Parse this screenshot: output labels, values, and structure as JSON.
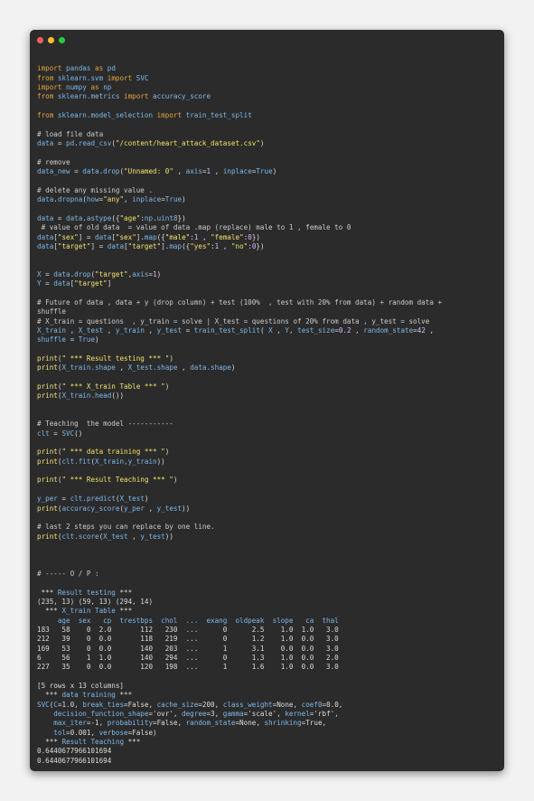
{
  "window": {
    "buttons": [
      {
        "name": "close",
        "color": "#ff5f57"
      },
      {
        "name": "minimize",
        "color": "#febc2e"
      },
      {
        "name": "maximize",
        "color": "#28c840"
      }
    ]
  },
  "colors": {
    "default": "#dcdcdc",
    "keyword": "#e8a33d",
    "ident": "#7eb8ea",
    "string": "#f2e36b",
    "number": "#d9b8ff",
    "comment": "#cccccc",
    "builtin": "#f5e07a"
  },
  "code_lines": [
    [],
    [
      [
        "k",
        "import"
      ],
      [
        "d",
        " "
      ],
      [
        "i",
        "pandas"
      ],
      [
        "d",
        " "
      ],
      [
        "k",
        "as"
      ],
      [
        "d",
        " "
      ],
      [
        "i",
        "pd"
      ]
    ],
    [
      [
        "k",
        "from"
      ],
      [
        "d",
        " "
      ],
      [
        "i",
        "sklearn.svm"
      ],
      [
        "d",
        " "
      ],
      [
        "k",
        "import"
      ],
      [
        "d",
        " "
      ],
      [
        "i",
        "SVC"
      ]
    ],
    [
      [
        "k",
        "import"
      ],
      [
        "d",
        " "
      ],
      [
        "i",
        "numpy"
      ],
      [
        "d",
        " "
      ],
      [
        "k",
        "as"
      ],
      [
        "d",
        " "
      ],
      [
        "i",
        "np"
      ]
    ],
    [
      [
        "k",
        "from"
      ],
      [
        "d",
        " "
      ],
      [
        "i",
        "sklearn.metrics"
      ],
      [
        "d",
        " "
      ],
      [
        "k",
        "import"
      ],
      [
        "d",
        " "
      ],
      [
        "i",
        "accuracy_score"
      ]
    ],
    [],
    [
      [
        "k",
        "from"
      ],
      [
        "d",
        " "
      ],
      [
        "i",
        "sklearn.model_selection"
      ],
      [
        "d",
        " "
      ],
      [
        "k",
        "import"
      ],
      [
        "d",
        " "
      ],
      [
        "i",
        "train_test_split"
      ]
    ],
    [],
    [
      [
        "c",
        "# load file data"
      ]
    ],
    [
      [
        "i",
        "data"
      ],
      [
        "d",
        " = "
      ],
      [
        "i",
        "pd"
      ],
      [
        "d",
        "."
      ],
      [
        "i",
        "read_csv"
      ],
      [
        "d",
        "("
      ],
      [
        "s",
        "\"/content/heart_attack_dataset.csv\""
      ],
      [
        "d",
        ")"
      ]
    ],
    [],
    [
      [
        "c",
        "# remove"
      ]
    ],
    [
      [
        "i",
        "data_new"
      ],
      [
        "d",
        " = "
      ],
      [
        "i",
        "data"
      ],
      [
        "d",
        "."
      ],
      [
        "i",
        "drop"
      ],
      [
        "d",
        "("
      ],
      [
        "s",
        "\"Unnamed: 0\""
      ],
      [
        "d",
        " , "
      ],
      [
        "i",
        "axis"
      ],
      [
        "d",
        "="
      ],
      [
        "n",
        "1"
      ],
      [
        "d",
        " , "
      ],
      [
        "i",
        "inplace"
      ],
      [
        "d",
        "="
      ],
      [
        "i",
        "True"
      ],
      [
        "d",
        ")"
      ]
    ],
    [],
    [
      [
        "c",
        "# delete any missing value ."
      ]
    ],
    [
      [
        "i",
        "data"
      ],
      [
        "d",
        "."
      ],
      [
        "i",
        "dropna"
      ],
      [
        "d",
        "("
      ],
      [
        "i",
        "how"
      ],
      [
        "d",
        "="
      ],
      [
        "s",
        "\"any\""
      ],
      [
        "d",
        ", "
      ],
      [
        "i",
        "inplace"
      ],
      [
        "d",
        "="
      ],
      [
        "i",
        "True"
      ],
      [
        "d",
        ")"
      ]
    ],
    [],
    [
      [
        "i",
        "data"
      ],
      [
        "d",
        " = "
      ],
      [
        "i",
        "data"
      ],
      [
        "d",
        "."
      ],
      [
        "i",
        "astype"
      ],
      [
        "d",
        "({"
      ],
      [
        "s",
        "\"age\""
      ],
      [
        "d",
        ":"
      ],
      [
        "i",
        "np"
      ],
      [
        "d",
        "."
      ],
      [
        "i",
        "uint8"
      ],
      [
        "d",
        "})"
      ]
    ],
    [
      [
        "c",
        " # value of old data  = value of data .map (replace) male to 1 , female to 0"
      ]
    ],
    [
      [
        "i",
        "data"
      ],
      [
        "d",
        "["
      ],
      [
        "s",
        "\"sex\""
      ],
      [
        "d",
        "] = "
      ],
      [
        "i",
        "data"
      ],
      [
        "d",
        "["
      ],
      [
        "s",
        "\"sex\""
      ],
      [
        "d",
        "]."
      ],
      [
        "i",
        "map"
      ],
      [
        "d",
        "({"
      ],
      [
        "s",
        "\"male\""
      ],
      [
        "d",
        ":"
      ],
      [
        "n",
        "1"
      ],
      [
        "d",
        " , "
      ],
      [
        "s",
        "\"female\""
      ],
      [
        "d",
        ":"
      ],
      [
        "n",
        "0"
      ],
      [
        "d",
        "})"
      ]
    ],
    [
      [
        "i",
        "data"
      ],
      [
        "d",
        "["
      ],
      [
        "s",
        "\"target\""
      ],
      [
        "d",
        "] = "
      ],
      [
        "i",
        "data"
      ],
      [
        "d",
        "["
      ],
      [
        "s",
        "\"target\""
      ],
      [
        "d",
        "]."
      ],
      [
        "i",
        "map"
      ],
      [
        "d",
        "({"
      ],
      [
        "s",
        "\"yes\""
      ],
      [
        "d",
        ":"
      ],
      [
        "n",
        "1"
      ],
      [
        "d",
        " , "
      ],
      [
        "s",
        "\"no\""
      ],
      [
        "d",
        ":"
      ],
      [
        "n",
        "0"
      ],
      [
        "d",
        "})"
      ]
    ],
    [],
    [],
    [
      [
        "i",
        "X"
      ],
      [
        "d",
        " = "
      ],
      [
        "i",
        "data"
      ],
      [
        "d",
        "."
      ],
      [
        "i",
        "drop"
      ],
      [
        "d",
        "("
      ],
      [
        "s",
        "\"target\""
      ],
      [
        "d",
        ","
      ],
      [
        "i",
        "axis"
      ],
      [
        "d",
        "="
      ],
      [
        "n",
        "1"
      ],
      [
        "d",
        ")"
      ]
    ],
    [
      [
        "i",
        "Y"
      ],
      [
        "d",
        " = "
      ],
      [
        "i",
        "data"
      ],
      [
        "d",
        "["
      ],
      [
        "s",
        "\"target\""
      ],
      [
        "d",
        "]"
      ]
    ],
    [],
    [
      [
        "c",
        "# Future of data , data + y (drop column) + test (100%  , test with 20% from data) + random data +"
      ]
    ],
    [
      [
        "c",
        "shuffle"
      ]
    ],
    [
      [
        "c",
        "# X_train = questions  , y_train = solve | X_test = questions of 20% from data , y_test = solve"
      ]
    ],
    [
      [
        "i",
        "X_train"
      ],
      [
        "d",
        " , "
      ],
      [
        "i",
        "X_test"
      ],
      [
        "d",
        " , "
      ],
      [
        "i",
        "y_train"
      ],
      [
        "d",
        " , "
      ],
      [
        "i",
        "y_test"
      ],
      [
        "d",
        " = "
      ],
      [
        "i",
        "train_test_split"
      ],
      [
        "d",
        "( "
      ],
      [
        "i",
        "X"
      ],
      [
        "d",
        " , "
      ],
      [
        "i",
        "Y"
      ],
      [
        "d",
        ", "
      ],
      [
        "i",
        "test_size"
      ],
      [
        "d",
        "="
      ],
      [
        "n",
        "0.2"
      ],
      [
        "d",
        " , "
      ],
      [
        "i",
        "random_state"
      ],
      [
        "d",
        "="
      ],
      [
        "n",
        "42"
      ],
      [
        "d",
        " ,"
      ]
    ],
    [
      [
        "i",
        "shuffle"
      ],
      [
        "d",
        " = "
      ],
      [
        "i",
        "True"
      ],
      [
        "d",
        ")"
      ]
    ],
    [],
    [
      [
        "b",
        "print"
      ],
      [
        "d",
        "("
      ],
      [
        "s",
        "\" *** Result testing *** \""
      ],
      [
        "d",
        ")"
      ]
    ],
    [
      [
        "b",
        "print"
      ],
      [
        "d",
        "("
      ],
      [
        "i",
        "X_train.shape"
      ],
      [
        "d",
        " , "
      ],
      [
        "i",
        "X_test.shape"
      ],
      [
        "d",
        " , "
      ],
      [
        "i",
        "data.shape"
      ],
      [
        "d",
        ")"
      ]
    ],
    [],
    [
      [
        "b",
        "print"
      ],
      [
        "d",
        "("
      ],
      [
        "s",
        "\" *** X_train Table *** \""
      ],
      [
        "d",
        ")"
      ]
    ],
    [
      [
        "b",
        "print"
      ],
      [
        "d",
        "("
      ],
      [
        "i",
        "X_train.head"
      ],
      [
        "d",
        "())"
      ]
    ],
    [],
    [],
    [
      [
        "c",
        "# Teaching  the model -----------"
      ]
    ],
    [
      [
        "i",
        "clt"
      ],
      [
        "d",
        " = "
      ],
      [
        "i",
        "SVC"
      ],
      [
        "d",
        "()"
      ]
    ],
    [],
    [
      [
        "b",
        "print"
      ],
      [
        "d",
        "("
      ],
      [
        "s",
        "\" *** data training *** \""
      ],
      [
        "d",
        ")"
      ]
    ],
    [
      [
        "b",
        "print"
      ],
      [
        "d",
        "("
      ],
      [
        "i",
        "clt.fit"
      ],
      [
        "d",
        "("
      ],
      [
        "i",
        "X_train,y_train"
      ],
      [
        "d",
        "))"
      ]
    ],
    [],
    [
      [
        "b",
        "print"
      ],
      [
        "d",
        "("
      ],
      [
        "s",
        "\" *** Result Teaching *** \""
      ],
      [
        "d",
        ")"
      ]
    ],
    [],
    [
      [
        "i",
        "y_per"
      ],
      [
        "d",
        " = "
      ],
      [
        "i",
        "clt.predict"
      ],
      [
        "d",
        "("
      ],
      [
        "i",
        "X_test"
      ],
      [
        "d",
        ")"
      ]
    ],
    [
      [
        "b",
        "print"
      ],
      [
        "d",
        "("
      ],
      [
        "i",
        "accuracy_score"
      ],
      [
        "d",
        "("
      ],
      [
        "i",
        "y_per"
      ],
      [
        "d",
        " , "
      ],
      [
        "i",
        "y_test"
      ],
      [
        "d",
        "))"
      ]
    ],
    [],
    [
      [
        "c",
        "# last 2 steps you can replace by one line."
      ]
    ],
    [
      [
        "b",
        "print"
      ],
      [
        "d",
        "("
      ],
      [
        "i",
        "clt.score"
      ],
      [
        "d",
        "("
      ],
      [
        "i",
        "X_test"
      ],
      [
        "d",
        " , "
      ],
      [
        "i",
        "y_test"
      ],
      [
        "d",
        "))"
      ]
    ],
    [],
    [],
    [],
    [
      [
        "c",
        "# ----- O / P :"
      ]
    ],
    [],
    [
      [
        "d",
        " *** "
      ],
      [
        "i",
        "Result testing"
      ],
      [
        "d",
        " ***"
      ]
    ],
    [
      [
        "d",
        "(235, 13) (59, 13) (294, 14)"
      ]
    ],
    [
      [
        "d",
        "  *** "
      ],
      [
        "i",
        "X_train Table"
      ],
      [
        "d",
        " ***"
      ]
    ],
    [
      [
        "i",
        "     age  sex   cp  trestbps  chol  ...  exang  oldpeak  slope   ca  thal"
      ]
    ],
    [
      [
        "d",
        "183   58    0  2.0       112   230  ...      0      2.5    1.0  1.0   3.0"
      ]
    ],
    [
      [
        "d",
        "212   39    0  0.0       118   219  ...      0      1.2    1.0  0.0   3.0"
      ]
    ],
    [
      [
        "d",
        "169   53    0  0.0       140   203  ...      1      3.1    0.0  0.0   3.0"
      ]
    ],
    [
      [
        "d",
        "6     56    1  1.0       140   294  ...      0      1.3    1.0  0.0   2.0"
      ]
    ],
    [
      [
        "d",
        "227   35    0  0.0       120   198  ...      1      1.6    1.0  0.0   3.0"
      ]
    ],
    [],
    [
      [
        "d",
        "[5 rows x 13 columns]"
      ]
    ],
    [
      [
        "d",
        "  *** "
      ],
      [
        "i",
        "data training"
      ],
      [
        "d",
        " ***"
      ]
    ],
    [
      [
        "i",
        "SVC"
      ],
      [
        "d",
        "("
      ],
      [
        "i",
        "C"
      ],
      [
        "d",
        "=1.0, "
      ],
      [
        "i",
        "break_ties"
      ],
      [
        "d",
        "=False, "
      ],
      [
        "i",
        "cache_size"
      ],
      [
        "d",
        "=200, "
      ],
      [
        "i",
        "class_weight"
      ],
      [
        "d",
        "=None, "
      ],
      [
        "i",
        "coef0"
      ],
      [
        "d",
        "=0.0,"
      ]
    ],
    [
      [
        "d",
        "    "
      ],
      [
        "i",
        "decision_function_shape"
      ],
      [
        "d",
        "='ovr', "
      ],
      [
        "i",
        "degree"
      ],
      [
        "d",
        "=3, "
      ],
      [
        "i",
        "gamma"
      ],
      [
        "d",
        "='scale', "
      ],
      [
        "i",
        "kernel"
      ],
      [
        "d",
        "='rbf',"
      ]
    ],
    [
      [
        "d",
        "    "
      ],
      [
        "i",
        "max_iter"
      ],
      [
        "d",
        "=-1, "
      ],
      [
        "i",
        "probability"
      ],
      [
        "d",
        "=False, "
      ],
      [
        "i",
        "random_state"
      ],
      [
        "d",
        "=None, "
      ],
      [
        "i",
        "shrinking"
      ],
      [
        "d",
        "=True,"
      ]
    ],
    [
      [
        "d",
        "    "
      ],
      [
        "i",
        "tol"
      ],
      [
        "d",
        "=0.001, "
      ],
      [
        "i",
        "verbose"
      ],
      [
        "d",
        "=False)"
      ]
    ],
    [
      [
        "d",
        "  *** "
      ],
      [
        "i",
        "Result Teaching"
      ],
      [
        "d",
        " ***"
      ]
    ],
    [
      [
        "d",
        "0.6440677966101694"
      ]
    ],
    [
      [
        "d",
        "0.6440677966101694"
      ]
    ]
  ]
}
